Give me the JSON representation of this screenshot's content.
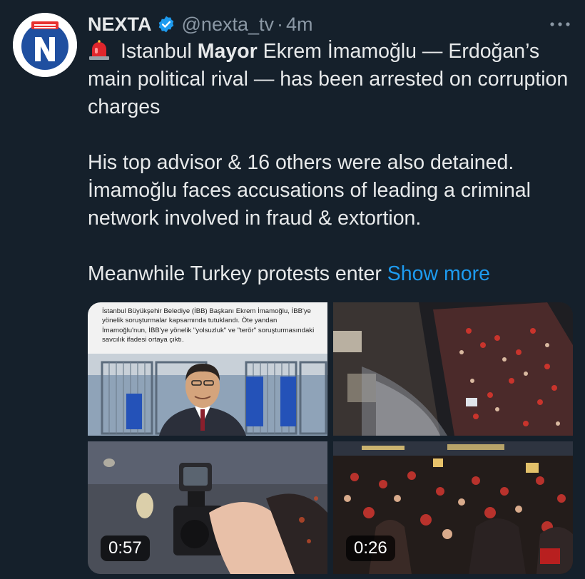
{
  "author": {
    "name": "NEXTA",
    "handle": "@nexta_tv",
    "separator": "·",
    "time": "4m",
    "verified_icon": "verified-badge-icon",
    "avatar_icon": "nexta-logo-icon"
  },
  "tweet": {
    "emoji": "police-siren-icon",
    "line1_prefix": "Istanbul ",
    "line1_bold": "Mayor",
    "line1_rest": " Ekrem İmamoğlu — Erdoğan’s main political rival — has been arrested on corruption charges",
    "paragraph2": "His top advisor & 16 others were also detained. İmamoğlu faces accusations of leading a criminal network involved in fraud & extortion.",
    "paragraph3_text": "Meanwhile Turkey protests enter ",
    "show_more": "Show more"
  },
  "media": {
    "image1_caption": "İstanbul Büyükşehir Belediye (İBB) Başkanı Ekrem İmamoğlu, İBB'ye yönelik soruşturmalar kapsamında tutuklandı. Öte yandan İmamoğlu'nun, İBB'ye yönelik \"yolsuzluk\" ve \"terör\" soruşturmasındaki savcılık ifadesi ortaya çıktı.",
    "video1_duration": "0:57",
    "video2_duration": "0:26"
  },
  "colors": {
    "background": "#15202b",
    "link": "#1d9bf0",
    "verified": "#1d9bf0",
    "secondary_text": "#8b98a5"
  }
}
